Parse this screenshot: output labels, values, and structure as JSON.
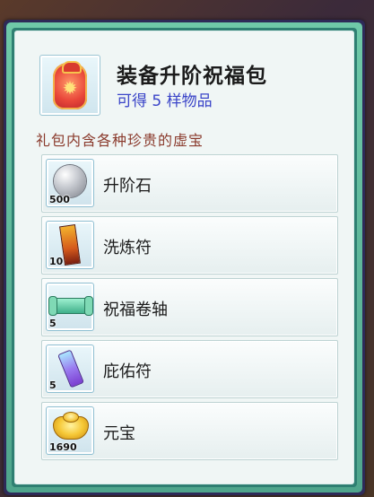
{
  "header": {
    "title": "装备升阶祝福包",
    "subtitle": "可得 5 样物品",
    "icon": "lucky-bag-icon"
  },
  "description": "礼包内含各种珍贵的虚宝",
  "items": [
    {
      "name": "升阶石",
      "quantity": "500",
      "icon": "upgrade-stone-icon"
    },
    {
      "name": "洗炼符",
      "quantity": "10",
      "icon": "refine-talisman-icon"
    },
    {
      "name": "祝福卷轴",
      "quantity": "5",
      "icon": "blessing-scroll-icon"
    },
    {
      "name": "庇佑符",
      "quantity": "5",
      "icon": "protection-charm-icon"
    },
    {
      "name": "元宝",
      "quantity": "1690",
      "icon": "gold-ingot-icon"
    }
  ],
  "colors": {
    "frame": "#4fa58c",
    "panel": "#f0f6f5",
    "subtitle": "#3a44c8",
    "description": "#8a3a2c"
  }
}
